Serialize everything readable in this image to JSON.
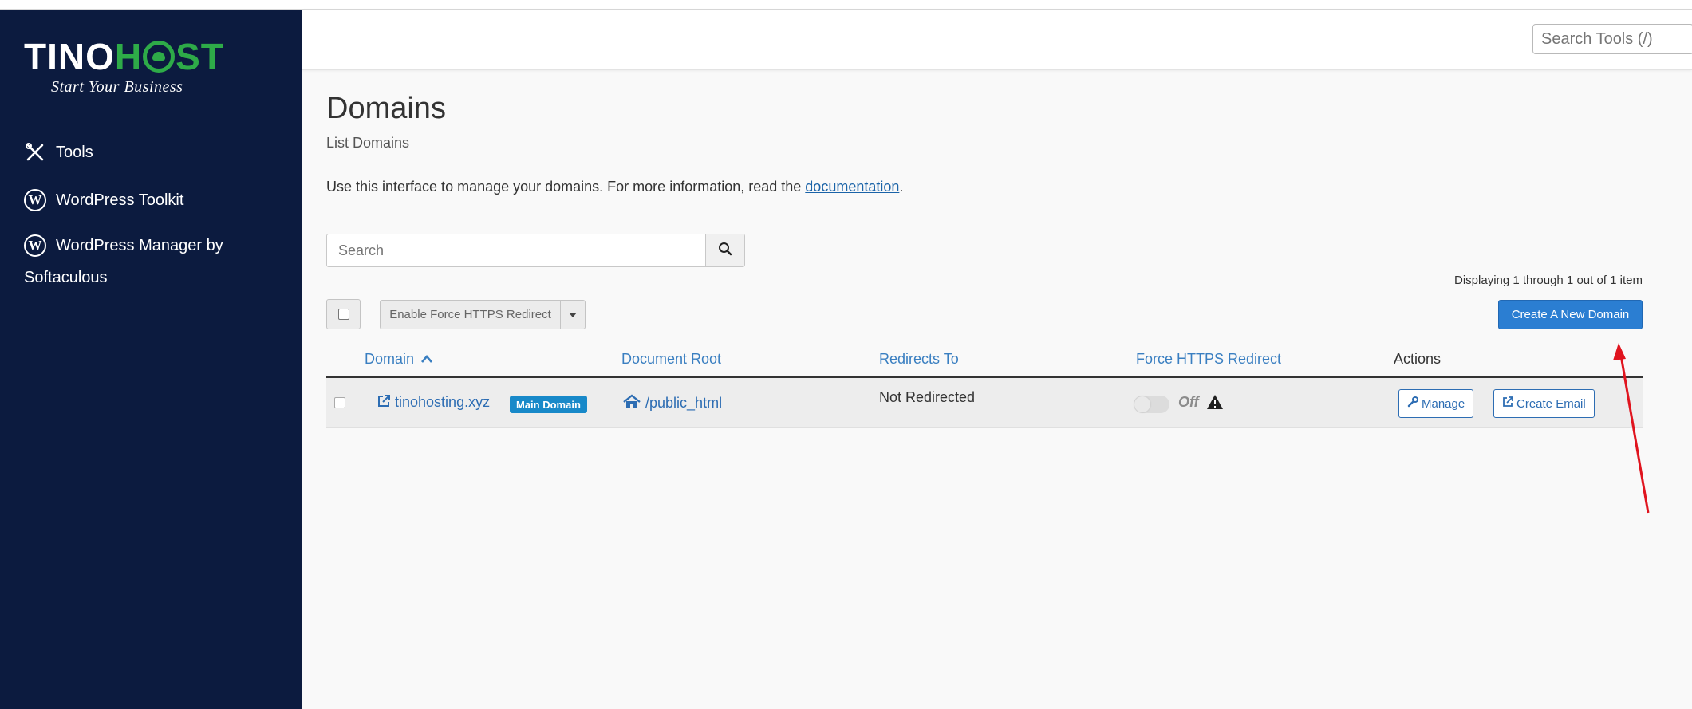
{
  "brand": {
    "name_left": "TINO",
    "name_right": "H",
    "name_right_tail": "ST",
    "tagline": "Start Your Business"
  },
  "sidebar": {
    "items": [
      {
        "label": "Tools",
        "icon": "tools-icon"
      },
      {
        "label": "WordPress Toolkit",
        "icon": "wordpress-icon"
      },
      {
        "label": "WordPress Manager by",
        "label_line2": "Softaculous",
        "icon": "wordpress-icon"
      }
    ]
  },
  "header": {
    "search_placeholder": "Search Tools (/)"
  },
  "page": {
    "title": "Domains",
    "subtitle": "List Domains",
    "intro_text": "Use this interface to manage your domains. For more information, read the ",
    "intro_link": "documentation",
    "intro_end": "."
  },
  "search": {
    "placeholder": "Search"
  },
  "pagination": {
    "text": "Displaying 1 through 1 out of 1 item"
  },
  "toolbar": {
    "force_https_label": "Enable Force HTTPS Redirect",
    "create_label": "Create A New Domain"
  },
  "table": {
    "headers": {
      "domain": "Domain",
      "document_root": "Document Root",
      "redirects_to": "Redirects To",
      "force_https": "Force HTTPS Redirect",
      "actions": "Actions"
    },
    "rows": [
      {
        "domain": "tinohosting.xyz",
        "badge": "Main Domain",
        "document_root": "/public_html",
        "redirects_to": "Not Redirected",
        "force_https_state": "Off",
        "actions": {
          "manage": "Manage",
          "create_email": "Create Email"
        }
      }
    ]
  },
  "colors": {
    "sidebar_bg": "#0c1b3f",
    "brand_green": "#2eab48",
    "primary": "#2b7ed2",
    "link": "#2d6db3",
    "annotation": "#e0141e"
  }
}
